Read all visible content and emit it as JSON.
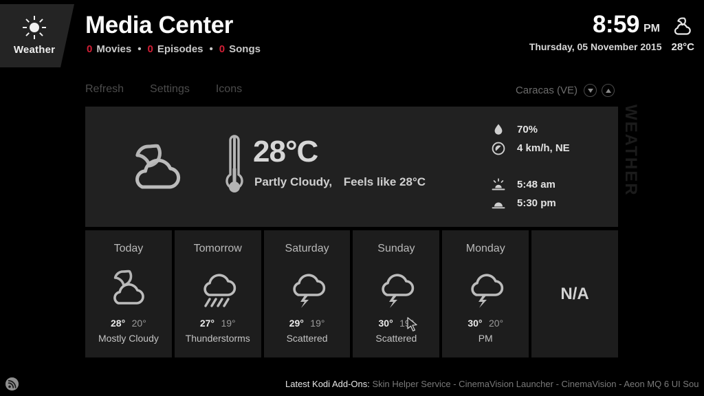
{
  "header": {
    "tab_label": "Weather",
    "tab_icon": "sun-icon",
    "title": "Media Center",
    "library": {
      "movies_count": "0",
      "movies_label": "Movies",
      "episodes_count": "0",
      "episodes_label": "Episodes",
      "songs_count": "0",
      "songs_label": "Songs",
      "separator": "•"
    },
    "clock": {
      "time": "8:59",
      "meridiem": "PM",
      "date": "Thursday, 05 November 2015",
      "temperature": "28°C",
      "icon": "moon-cloud-icon"
    }
  },
  "menu": {
    "items": [
      {
        "label": "Refresh",
        "name": "refresh"
      },
      {
        "label": "Settings",
        "name": "settings"
      },
      {
        "label": "Icons",
        "name": "icons"
      }
    ],
    "location": "Caracas (VE)",
    "spinner_down_icon": "arrow-down-icon",
    "spinner_up_icon": "arrow-up-icon"
  },
  "watermark": "WEATHER",
  "current": {
    "icon": "moon-cloud-icon",
    "thermometer_icon": "thermometer-icon",
    "temperature": "28°C",
    "condition": "Partly Cloudy,",
    "feels_like": "Feels like 28°C",
    "details": [
      {
        "icon": "humidity-droplet-icon",
        "value": "70%",
        "name": "humidity"
      },
      {
        "icon": "wind-compass-icon",
        "value": "4 km/h,  NE",
        "name": "wind"
      },
      {
        "icon": "sunrise-icon",
        "value": "5:48 am",
        "name": "sunrise"
      },
      {
        "icon": "sunset-icon",
        "value": "5:30 pm",
        "name": "sunset"
      }
    ]
  },
  "forecast": [
    {
      "day": "Today",
      "icon": "moon-cloud-icon",
      "high": "28°",
      "low": "20°",
      "condition": "Mostly Cloudy"
    },
    {
      "day": "Tomorrow",
      "icon": "rain-cloud-icon",
      "high": "27°",
      "low": "19°",
      "condition": "Thunderstorms"
    },
    {
      "day": "Saturday",
      "icon": "storm-cloud-icon",
      "high": "29°",
      "low": "19°",
      "condition": "Scattered"
    },
    {
      "day": "Sunday",
      "icon": "storm-cloud-icon",
      "high": "30°",
      "low": "19°",
      "condition": "Scattered"
    },
    {
      "day": "Monday",
      "icon": "storm-cloud-icon",
      "high": "30°",
      "low": "20°",
      "condition": "PM"
    },
    {
      "day": "",
      "icon": "",
      "high": "",
      "low": "",
      "condition": "",
      "na": "N/A"
    }
  ],
  "footer": {
    "rss_icon": "rss-icon",
    "rss_label": "Latest Kodi Add-Ons:",
    "rss_body": " Skin Helper Service - CinemaVision Launcher - CinemaVision - Aeon MQ 6 UI Sou"
  },
  "colors": {
    "background": "#000000",
    "panel": "#212121",
    "card": "#1d1d1d",
    "accent_red": "#d31f36",
    "icon_gray": "#b4b4b4"
  }
}
